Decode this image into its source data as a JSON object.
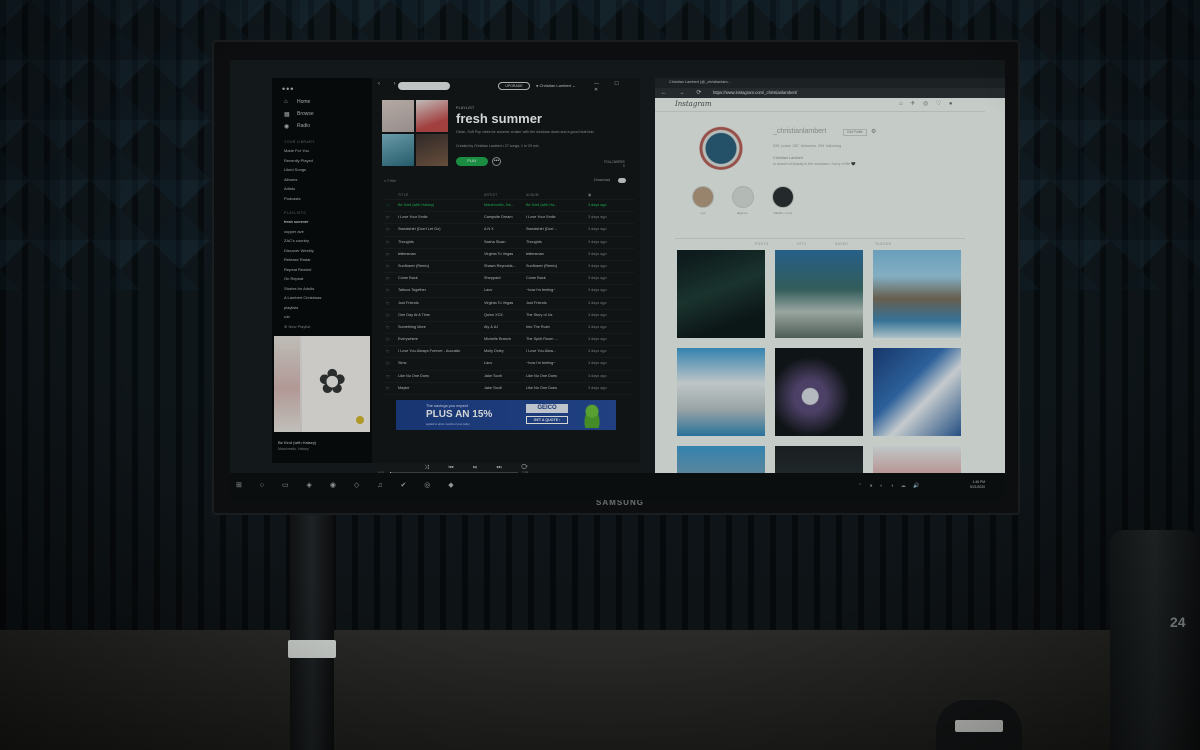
{
  "scene": {
    "monitor_brand": "SAMSUNG",
    "bottle_label": "24"
  },
  "spotify": {
    "menu_dots": "•••",
    "nav": [
      {
        "icon": "home-icon",
        "glyph": "⌂",
        "label": "Home"
      },
      {
        "icon": "browse-icon",
        "glyph": "▦",
        "label": "Browse"
      },
      {
        "icon": "radio-icon",
        "glyph": "◉",
        "label": "Radio"
      }
    ],
    "library_heading": "YOUR LIBRARY",
    "library": [
      "Made For You",
      "Recently Played",
      "Liked Songs",
      "Albums",
      "Artists",
      "Podcasts"
    ],
    "playlists_heading": "PLAYLISTS",
    "playlists": [
      "fresh summer",
      "copper ave",
      "ZAC's country",
      "Discover Weekly",
      "Release Radar",
      "Repeat Rewind",
      "On Repeat",
      "Stories for Adults",
      "A Lambert Christmas",
      "playlists",
      "rob"
    ],
    "active_playlist": "fresh summer",
    "new_playlist": "New Playlist",
    "now_playing_title": "Be Kind (with Halsey)",
    "now_playing_artist": "Marshmello, Halsey",
    "upgrade": "UPGRADE",
    "user": "Christian Lambert",
    "window_controls": "— ☐ ✕",
    "back_forward": "‹ ›",
    "playlist": {
      "kicker": "PLAYLIST",
      "title": "fresh summer",
      "description": "Clean, Soft Pop vibes for summer cruisin' with the windows down and a good heat bub.",
      "meta": "Created by Christian Lambert • 27 songs, 1 hr 29 min",
      "play": "PLAY",
      "more": "•••",
      "followers_label": "FOLLOWERS",
      "followers_value": "0"
    },
    "filter": "Filter",
    "download": "Download",
    "columns": {
      "title": "TITLE",
      "artist": "ARTIST",
      "album": "ALBUM"
    },
    "tracks": [
      {
        "title": "Be Kind (with Halsey)",
        "artist": "Marshmello, Ha...",
        "album": "Be Kind (with Ha...",
        "date": "3 days ago",
        "playing": true
      },
      {
        "title": "I Love Your Smile",
        "artist": "Campsite Dream",
        "album": "I Love Your Smile",
        "date": "3 days ago"
      },
      {
        "title": "Sweatshirt (Don't Let Go)",
        "artist": "A N X",
        "album": "Sweatshirt (Don'...",
        "date": "3 days ago"
      },
      {
        "title": "Thoughts",
        "artist": "Sasha Sloan",
        "album": "Thoughts",
        "date": "3 days ago"
      },
      {
        "title": "bittersman",
        "artist": "Virginia To Vegas",
        "album": "bittersman",
        "date": "3 days ago"
      },
      {
        "title": "Sunflower (Remix)",
        "artist": "Shawn Reynolds...",
        "album": "Sunflower (Remix)",
        "date": "3 days ago"
      },
      {
        "title": "Come Back",
        "artist": "Sheppard",
        "album": "Come Back",
        "date": "3 days ago"
      },
      {
        "title": "Tattoos Together",
        "artist": "Lauv",
        "album": "~how i'm feeling~",
        "date": "3 days ago"
      },
      {
        "title": "Just Friends",
        "artist": "Virginia To Vegas",
        "album": "Just Friends",
        "date": "3 days ago"
      },
      {
        "title": "One Day At A Time",
        "artist": "Quinn XCII",
        "album": "The Story of Us",
        "date": "3 days ago"
      },
      {
        "title": "Something More",
        "artist": "Aly & AJ",
        "album": "Into The Rush",
        "date": "3 days ago"
      },
      {
        "title": "Everywhere",
        "artist": "Michelle Branch",
        "album": "The Spirit Room ...",
        "date": "3 days ago"
      },
      {
        "title": "I Love You Always Forever - Acoustic",
        "artist": "Molly Oxley",
        "album": "I Love You Alwa...",
        "date": "3 days ago"
      },
      {
        "title": "Sims",
        "artist": "Lauv",
        "album": "~how i'm feeling~",
        "date": "3 days ago"
      },
      {
        "title": "Like No One Does",
        "artist": "Jake Scott",
        "album": "Like No One Does",
        "date": "3 days ago"
      },
      {
        "title": "Maybe",
        "artist": "Jake Scott",
        "album": "Like No One Does",
        "date": "3 days ago"
      }
    ],
    "ad": {
      "small": "The savings you expect",
      "big": "PLUS AN 15%",
      "additional": "ADDITIONAL",
      "tiny": "applied to all six months of your policy",
      "brand": "GEICO",
      "cta": "GET A QUOTE ›"
    },
    "player": {
      "controls": "⤨ ⏮ ⏯ ⏭ ⟳",
      "elapsed": "0:01",
      "duration": "3:38",
      "progress": 0.01
    }
  },
  "browser": {
    "tab_title": "Christian Lambert (@_christianlam...",
    "nav": "← → ⟳",
    "url": "https://www.instagram.com/_christianlambert/",
    "instagram": {
      "logo": "Instagram",
      "nav_icons": "⌂ ✈ ◎ ♡ ●",
      "username": "_christianlambert",
      "edit_profile": "Edit Profile",
      "stats": "226 posts   287 followers   294 following",
      "full_name": "Christian Lambert",
      "bio": "in search of beauty in the mundane • hurry of life 🖤",
      "highlights": [
        {
          "label": "nyc",
          "bg": "#b79c7f"
        },
        {
          "label": "dogs of...",
          "bg": "#d8ddd8"
        },
        {
          "label": "GEAR + more",
          "bg": "#2a2f31"
        }
      ],
      "tabs": [
        "POSTS",
        "IGTV",
        "SAVED",
        "TAGGED"
      ],
      "photos": [
        {
          "bg": "linear-gradient(160deg,#0f1e1f 10%,#1e3a33 45%,#0c1617 80%)"
        },
        {
          "bg": "linear-gradient(180deg,#2d6fa3 0%,#3c6d6a 45%,#b9c6c0 70%,#5d6d63 100%)"
        },
        {
          "bg": "linear-gradient(180deg,#7fbde0 0%,#9fd0e8 30%,#7c6f5b 55%,#3f86b2 80%,#cfe6ee 100%)"
        },
        {
          "bg": "linear-gradient(180deg,#3d9bd1 0%,#e6edee 40%,#b8c3c6 70%,#2f86b7 100%)"
        },
        {
          "bg": "radial-gradient(circle at 40% 55%,#d8dde4 0 8px,#5b4a78 9px 16px,#101416 40px)"
        },
        {
          "bg": "linear-gradient(135deg,#1b3f7e 0%,#3470b6 40%,#eef3f5 60%,#2a5c9b 100%)"
        },
        {
          "bg": "linear-gradient(180deg,#3d9bd1 0%,#d6a989 100%)"
        },
        {
          "bg": "linear-gradient(180deg,#1c2123 0%,#3a4346 100%)"
        },
        {
          "bg": "linear-gradient(180deg,#e8eeee 0%,#d77a7a 60%,#2b2f31 100%)"
        }
      ]
    }
  },
  "taskbar": {
    "icons": "⊞ ○ ▭ ◈ ◉ ◇ ♫ ✔ ◎ ◆",
    "tray": "⌃ ● ◐ ◑ ☁ 🔊",
    "time": "1:46 PM",
    "date": "5/21/2020"
  }
}
